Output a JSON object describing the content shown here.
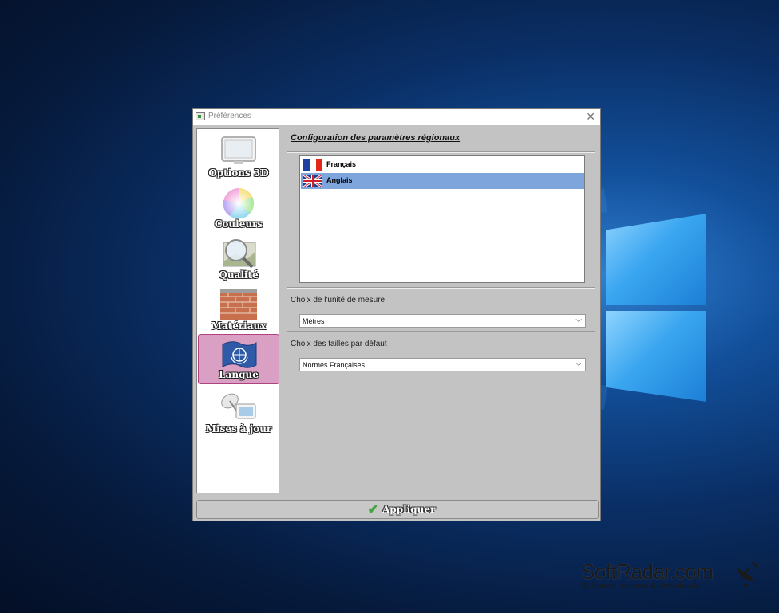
{
  "window": {
    "title": "Préférences",
    "close_glyph": "✕"
  },
  "sidebar": {
    "items": [
      {
        "label": "Options 3D",
        "icon": "monitor-icon",
        "selected": false
      },
      {
        "label": "Couleurs",
        "icon": "color-wheel-icon",
        "selected": false
      },
      {
        "label": "Qualité",
        "icon": "magnifier-icon",
        "selected": false
      },
      {
        "label": "Matériaux",
        "icon": "brick-wall-icon",
        "selected": false
      },
      {
        "label": "Langue",
        "icon": "un-flag-icon",
        "selected": true
      },
      {
        "label": "Mises à jour",
        "icon": "satellite-dish-icon",
        "selected": false
      }
    ]
  },
  "main": {
    "heading": "Configuration des paramètres régionaux",
    "languages": [
      {
        "name": "Français",
        "flag": "france-flag-icon",
        "selected": false
      },
      {
        "name": "Anglais",
        "flag": "uk-flag-icon",
        "selected": true
      }
    ],
    "unit_label": "Choix de l'unité de mesure",
    "unit_value": "Mètres",
    "size_label": "Choix des tailles par défaut",
    "size_value": "Normes Françaises"
  },
  "apply_button": {
    "label": "Appliquer",
    "icon": "checkmark-icon"
  },
  "watermark": {
    "brand": "SoftRadar.com",
    "tagline": "Software reviews & downloads"
  },
  "colors": {
    "selected_sidebar": "#d9a0c4",
    "selected_row": "#7fa6dc",
    "dialog_bg": "#c3c3c3"
  }
}
